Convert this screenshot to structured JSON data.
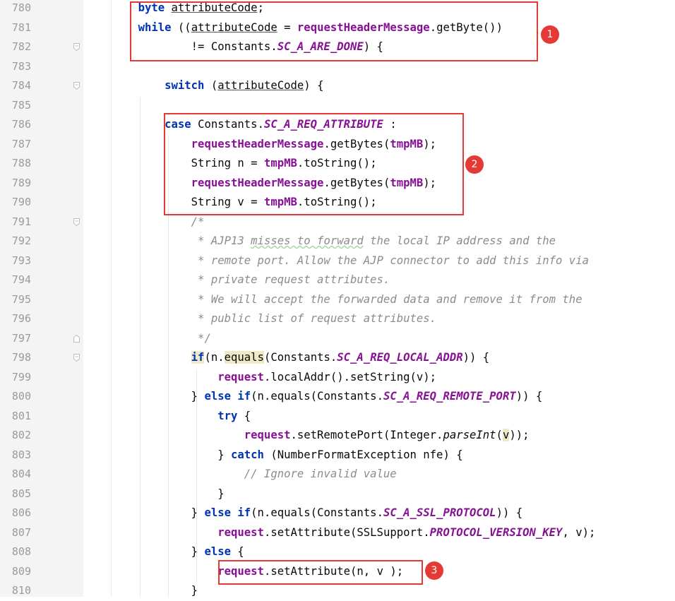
{
  "line_numbers": [
    "780",
    "781",
    "782",
    "783",
    "784",
    "785",
    "786",
    "787",
    "788",
    "789",
    "790",
    "791",
    "792",
    "793",
    "794",
    "795",
    "796",
    "797",
    "798",
    "799",
    "800",
    "801",
    "802",
    "803",
    "804",
    "805",
    "806",
    "807",
    "808",
    "809",
    "810"
  ],
  "tokens": {
    "byte": "byte",
    "while": "while",
    "switch": "switch",
    "case": "case",
    "string": "String",
    "if": "if",
    "else_if": "else if",
    "try": "try",
    "catch": "catch",
    "else": "else",
    "attributeCode": "attributeCode",
    "requestHeaderMessage": "requestHeaderMessage",
    "getByte": "getByte",
    "getBytes": "getBytes",
    "constants": "Constants",
    "SC_A_ARE_DONE": "SC_A_ARE_DONE",
    "SC_A_REQ_ATTRIBUTE": "SC_A_REQ_ATTRIBUTE",
    "tmpMB": "tmpMB",
    "toString": "toString",
    "n": "n",
    "v": "v",
    "equals": "equals",
    "SC_A_REQ_LOCAL_ADDR": "SC_A_REQ_LOCAL_ADDR",
    "request": "request",
    "localAddr": "localAddr",
    "setString": "setString",
    "SC_A_REQ_REMOTE_PORT": "SC_A_REQ_REMOTE_PORT",
    "setRemotePort": "setRemotePort",
    "Integer": "Integer",
    "parseInt": "parseInt",
    "NumberFormatException": "NumberFormatException",
    "nfe": "nfe",
    "SC_A_SSL_PROTOCOL": "SC_A_SSL_PROTOCOL",
    "setAttribute": "setAttribute",
    "SSLSupport": "SSLSupport",
    "PROTOCOL_VERSION_KEY": "PROTOCOL_VERSION_KEY"
  },
  "comment_lines": [
    "/*",
    " * AJP13 ",
    "misses to forward",
    " the local IP address and the",
    " * remote port. Allow the AJP connector to add this info via",
    " * private request attributes.",
    " * We will accept the forwarded data and remove it from the",
    " * public list of request attributes.",
    " */",
    "// Ignore invalid value"
  ],
  "annotations": [
    "1",
    "2",
    "3"
  ],
  "colors": {
    "keyword": "#0033b3",
    "field": "#871094",
    "comment": "#8c8c8c",
    "annotation_red": "#e53935",
    "gutter": "#f4f4f4"
  }
}
